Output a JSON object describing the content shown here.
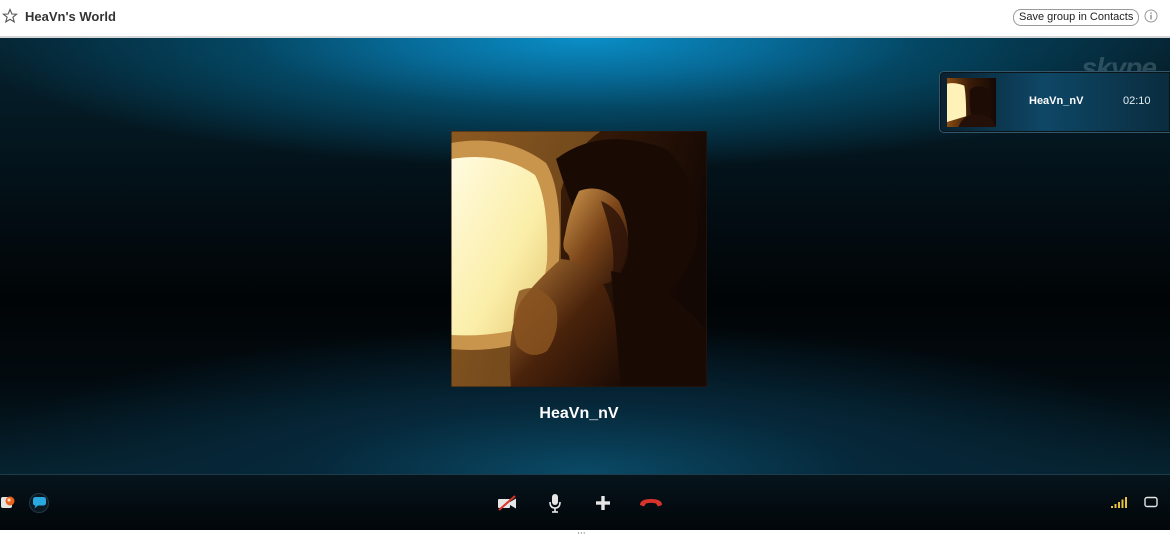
{
  "window": {
    "title": "HeaVn's World",
    "save_group_label": "Save group in Contacts"
  },
  "icons": {
    "favorite": "star-icon",
    "info": "info-icon",
    "watermark": "skype-logo",
    "bottom_left": [
      "contacts-icon",
      "chat-icon"
    ],
    "call_controls": [
      "video-off-icon",
      "microphone-icon",
      "add-icon",
      "hang-up-icon"
    ],
    "bottom_right": [
      "signal-strength-icon",
      "fullscreen-icon"
    ]
  },
  "watermark_text": "skype",
  "call": {
    "participant_name": "HeaVn_nV",
    "thumbnail_name": "HeaVn_nV",
    "duration": "02:10"
  },
  "colors": {
    "hang_up": "#d9342b",
    "chat_bubble": "#29a9e0",
    "signal_bars": "#e8c23a"
  }
}
